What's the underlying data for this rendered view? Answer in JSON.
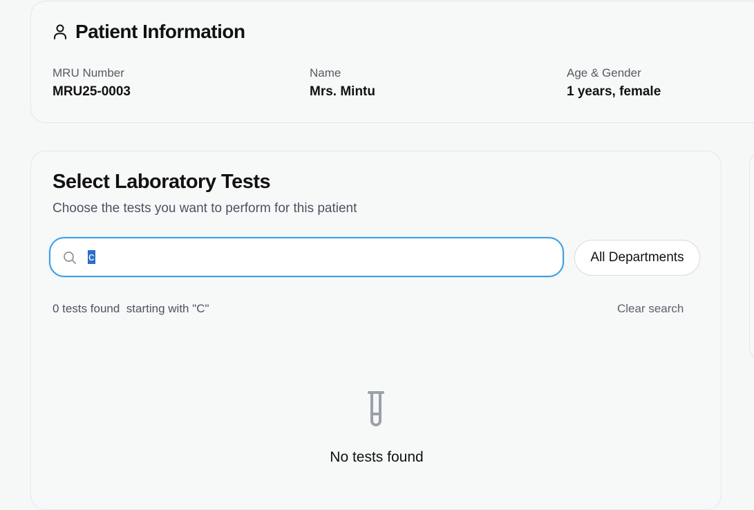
{
  "patient_info": {
    "title": "Patient Information",
    "icon": "user-icon",
    "fields": [
      {
        "label": "MRU Number",
        "value": "MRU25-0003"
      },
      {
        "label": "Name",
        "value": "Mrs. Mintu"
      },
      {
        "label": "Age & Gender",
        "value": "1 years, female"
      }
    ]
  },
  "tests": {
    "title": "Select Laboratory Tests",
    "subtitle": "Choose the tests you want to perform for this patient",
    "search": {
      "icon": "search-icon",
      "value": "c"
    },
    "department_filter": {
      "selected": "All Departments"
    },
    "result_count": "0 tests found  starting with \"C\"",
    "clear_search_label": "Clear search",
    "empty_state": {
      "icon": "test-tube-icon",
      "title": "No tests found"
    }
  },
  "colors": {
    "accent": "#3b9ee6",
    "selection": "#2d6ec9",
    "icon_gray": "#9aa1a8"
  }
}
